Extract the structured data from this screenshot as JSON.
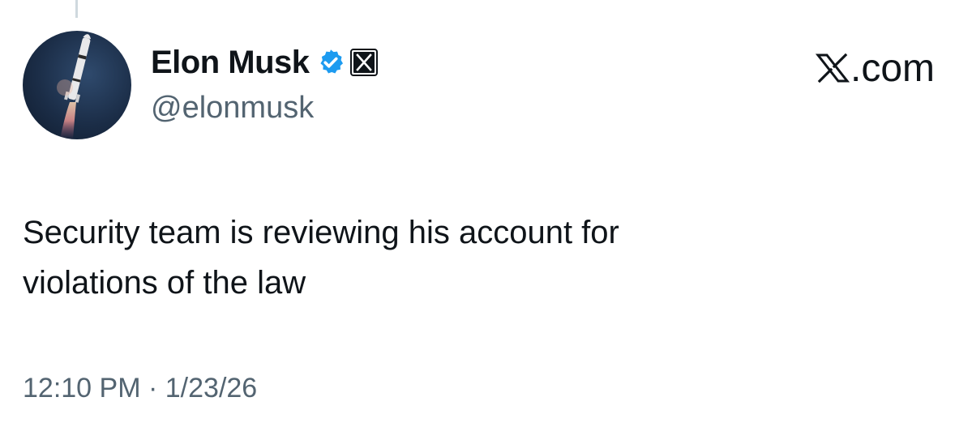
{
  "author": {
    "display_name": "Elon Musk",
    "handle": "@elonmusk",
    "verified_icon": "verified-badge-icon",
    "affiliation_icon": "x-logo-icon"
  },
  "brand": {
    "icon": "x-logo-icon",
    "domain": ".com"
  },
  "tweet": {
    "text_line1": "Security team is reviewing his account for",
    "text_line2": "violations of the law",
    "time": "12:10 PM",
    "separator": "·",
    "date": "1/23/26"
  },
  "colors": {
    "text": "#0f1419",
    "muted": "#536471",
    "verified": "#1d9bf0",
    "thread_line": "#cfd9de"
  }
}
